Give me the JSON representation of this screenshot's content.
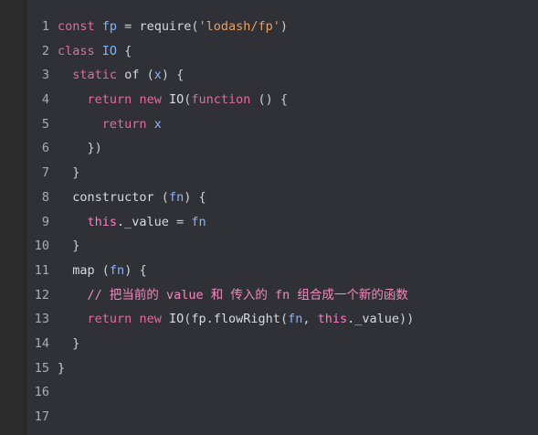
{
  "editor": {
    "lines": [
      {
        "num": "1"
      },
      {
        "num": "2"
      },
      {
        "num": "3"
      },
      {
        "num": "4"
      },
      {
        "num": "5"
      },
      {
        "num": "6"
      },
      {
        "num": "7"
      },
      {
        "num": "8"
      },
      {
        "num": "9"
      },
      {
        "num": "10"
      },
      {
        "num": "11"
      },
      {
        "num": "12"
      },
      {
        "num": "13"
      },
      {
        "num": "14"
      },
      {
        "num": "15"
      },
      {
        "num": "16"
      },
      {
        "num": "17"
      }
    ],
    "tokens": {
      "l1": [
        "const",
        " ",
        "fp",
        " = ",
        "require",
        "(",
        "'lodash/fp'",
        ")"
      ],
      "l2": [
        "class",
        " ",
        "IO",
        " {"
      ],
      "l3": [
        "  ",
        "static",
        " ",
        "of",
        " (",
        "x",
        ") {"
      ],
      "l4": [
        "    ",
        "return",
        " ",
        "new",
        " ",
        "IO",
        "(",
        "function",
        " () {"
      ],
      "l5": [
        "      ",
        "return",
        " ",
        "x"
      ],
      "l6": [
        "    ",
        "})"
      ],
      "l7": [
        "  ",
        "}"
      ],
      "l8": [
        "  ",
        "constructor",
        " (",
        "fn",
        ") {"
      ],
      "l9": [
        "    ",
        "this",
        "._value",
        " = ",
        "fn"
      ],
      "l10": [
        "  ",
        "}"
      ],
      "l11": [
        "  ",
        "map",
        " (",
        "fn",
        ") {"
      ],
      "l12": [
        "    ",
        "// 把当前的 value 和 传入的 fn 组合成一个新的函数"
      ],
      "l13": [
        "    ",
        "return",
        " ",
        "new",
        " ",
        "IO",
        "(",
        "fp",
        ".",
        "flowRight",
        "(",
        "fn",
        ", ",
        "this",
        "._value",
        "))"
      ],
      "l14": [
        "  ",
        "}"
      ],
      "l15": [
        "}"
      ],
      "l16": [
        ""
      ],
      "l17": [
        ""
      ]
    }
  }
}
